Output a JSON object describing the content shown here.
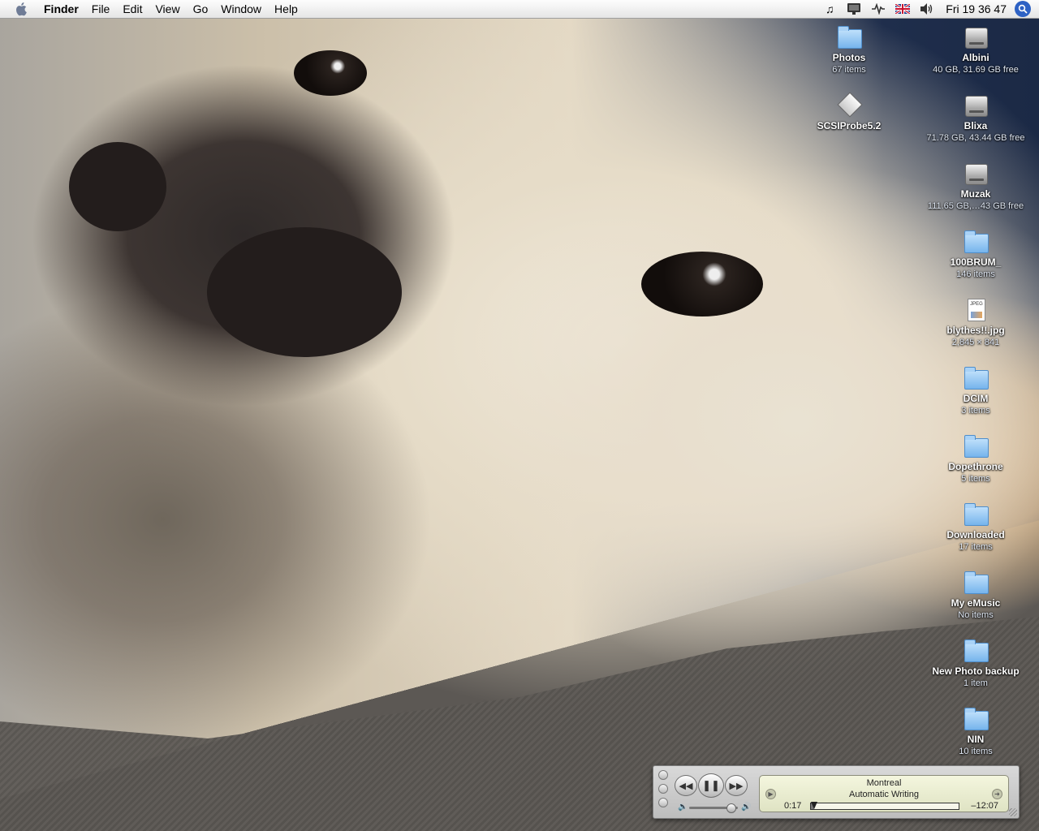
{
  "menubar": {
    "app_name": "Finder",
    "menus": [
      "File",
      "Edit",
      "View",
      "Go",
      "Window",
      "Help"
    ],
    "status_icons": [
      "music-note-icon",
      "display-icon",
      "activity-icon",
      "uk-flag-icon",
      "volume-icon"
    ],
    "clock": "Fri 19 36 47"
  },
  "desktop_icons": [
    {
      "name": "Photos",
      "info": "67 items",
      "type": "folder"
    },
    {
      "name": "SCSIProbe5.2",
      "info": "",
      "type": "application"
    },
    {
      "name": "Albini",
      "info": "40 GB, 31.69 GB free",
      "type": "disk"
    },
    {
      "name": "Blixa",
      "info": "71.78 GB, 43.44 GB free",
      "type": "disk"
    },
    {
      "name": "Muzak",
      "info": "111.65 GB,…43 GB free",
      "type": "disk"
    },
    {
      "name": "100BRUM_",
      "info": "146 items",
      "type": "folder"
    },
    {
      "name": "blythes!!.jpg",
      "info": "2,845 × 841",
      "type": "jpeg"
    },
    {
      "name": "DCIM",
      "info": "3 items",
      "type": "folder"
    },
    {
      "name": "Dopethrone",
      "info": "5 items",
      "type": "folder"
    },
    {
      "name": "Downloaded",
      "info": "17 items",
      "type": "folder"
    },
    {
      "name": "My eMusic",
      "info": "No items",
      "type": "folder"
    },
    {
      "name": "New Photo backup",
      "info": "1 item",
      "type": "folder"
    },
    {
      "name": "NIN",
      "info": "10 items",
      "type": "folder"
    }
  ],
  "jpeg_badge": "JPEG",
  "itunes": {
    "song": "Montreal",
    "artist": "Automatic Writing",
    "elapsed": "0:17",
    "remaining": "–12:07",
    "progress": 0.02,
    "volume": 0.85,
    "state": "playing"
  }
}
